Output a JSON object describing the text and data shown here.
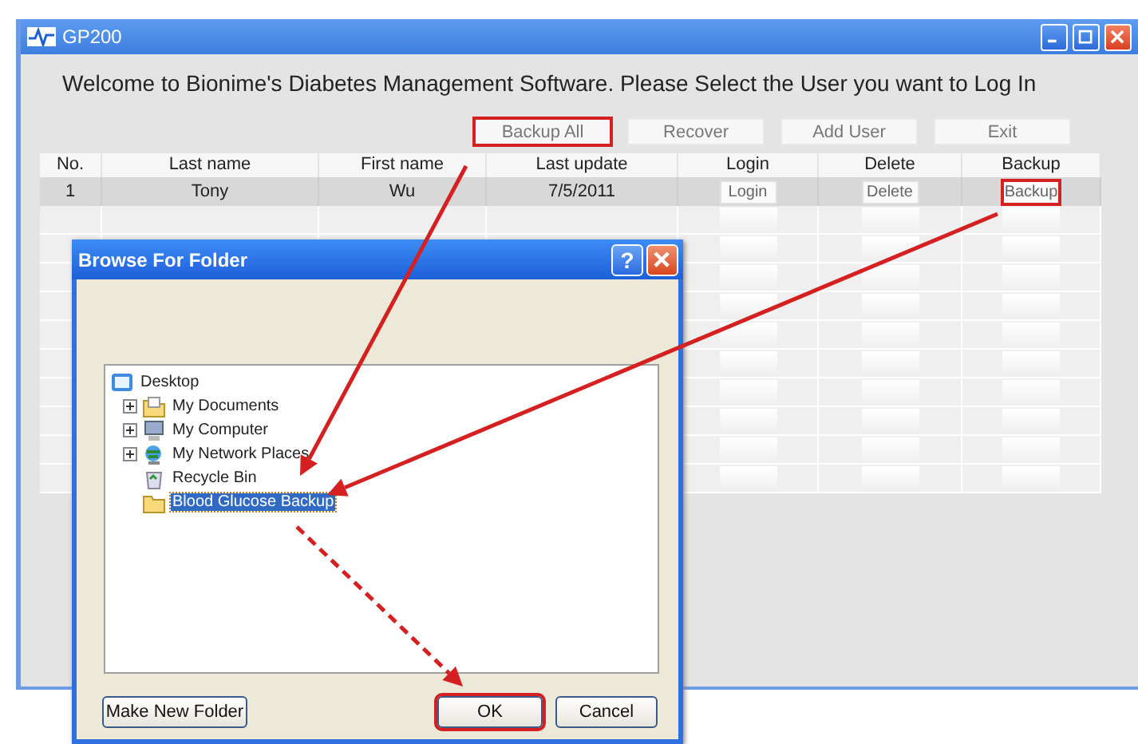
{
  "window": {
    "title": "GP200"
  },
  "welcome": "Welcome to Bionime's Diabetes Management Software. Please Select the User you want to Log In",
  "toolbar": [
    {
      "label": "Backup All",
      "highlighted": true
    },
    {
      "label": "Recover",
      "highlighted": false
    },
    {
      "label": "Add User",
      "highlighted": false
    },
    {
      "label": "Exit",
      "highlighted": false
    }
  ],
  "table": {
    "columns": [
      "No.",
      "Last name",
      "First name",
      "Last update",
      "Login",
      "Delete",
      "Backup"
    ],
    "rows": [
      {
        "cells": [
          "1",
          "Tony",
          "Wu",
          "7/5/2011"
        ],
        "actions": [
          {
            "label": "Login",
            "highlighted": false
          },
          {
            "label": "Delete",
            "highlighted": false
          },
          {
            "label": "Backup",
            "highlighted": true
          }
        ]
      }
    ]
  },
  "dialog": {
    "title": "Browse For Folder",
    "help": "?",
    "tree": {
      "label": "Desktop",
      "kind": "desktop",
      "children": [
        {
          "label": "My Documents",
          "kind": "documents",
          "expander": true,
          "selected": false
        },
        {
          "label": "My Computer",
          "kind": "computer",
          "expander": true,
          "selected": false
        },
        {
          "label": "My Network Places",
          "kind": "network",
          "expander": true,
          "selected": false
        },
        {
          "label": "Recycle Bin",
          "kind": "recycle",
          "expander": false,
          "selected": false
        },
        {
          "label": "Blood Glucose Backup",
          "kind": "folder",
          "expander": false,
          "selected": true
        }
      ]
    },
    "buttons": [
      {
        "label": "Make New Folder",
        "highlighted": false
      },
      {
        "label": "OK",
        "highlighted": true
      },
      {
        "label": "Cancel",
        "highlighted": false
      }
    ]
  }
}
